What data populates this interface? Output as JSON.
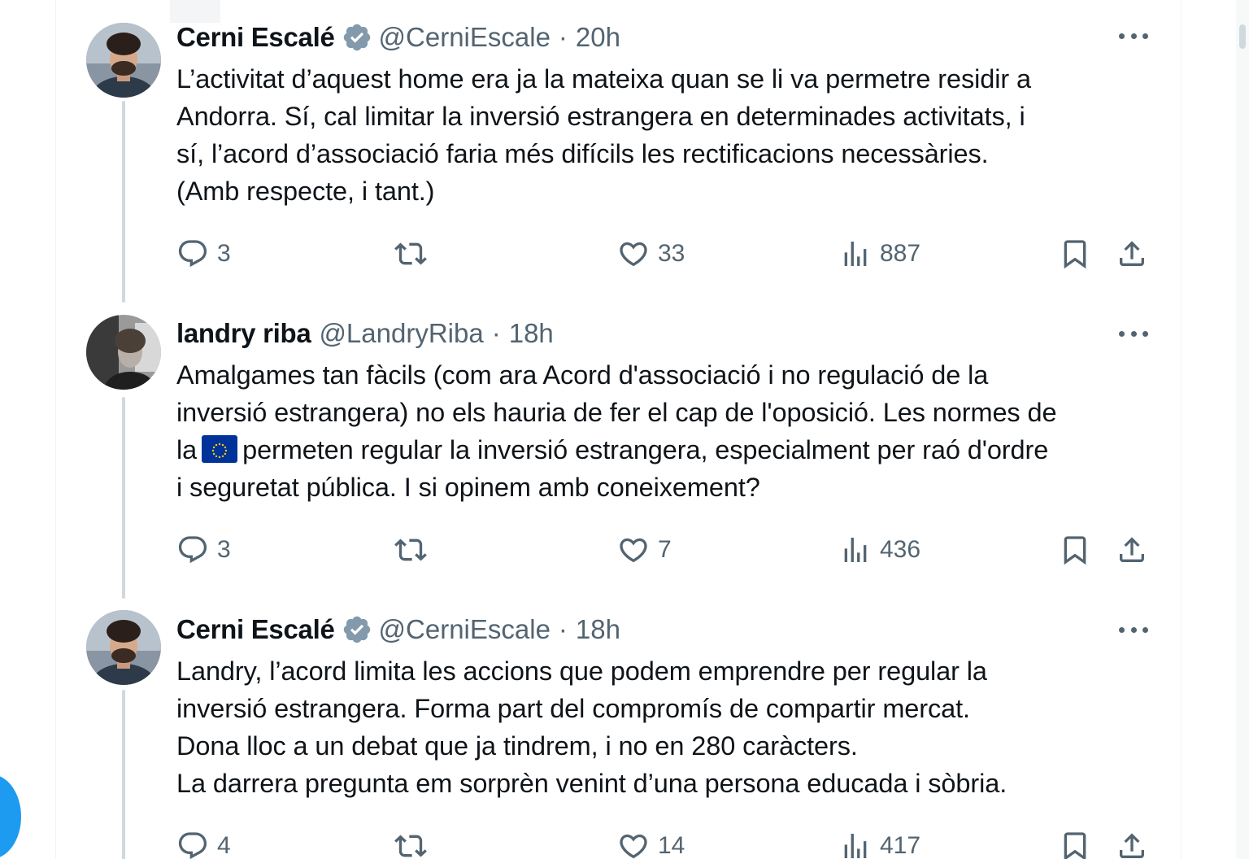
{
  "tweets": [
    {
      "name": "Cerni Escalé",
      "verified": true,
      "handle": "@CerniEscale",
      "dot": "·",
      "time": "20h",
      "lines": [
        "L’activitat d’aquest home era ja la mateixa quan se li va permetre residir a",
        "Andorra. Sí, cal limitar la inversió estrangera en determinades activitats, i",
        "sí, l’acord d’associació faria més difícils les rectificacions necessàries.",
        "(Amb respecte, i tant.)"
      ],
      "replies": "3",
      "retweets": "",
      "likes": "33",
      "views": "887"
    },
    {
      "name": "landry riba",
      "verified": false,
      "handle": "@LandryRiba",
      "dot": "·",
      "time": "18h",
      "lines": [
        "Amalgames tan fàcils (com ara Acord d'associació i no regulació de la",
        "inversió estrangera) no els hauria de fer el cap de l'oposició.  Les normes de"
      ],
      "line3_before": "la",
      "line3_after": "permeten regular la inversió estrangera, especialment per  raó d'ordre",
      "line4": "i seguretat pública. I si opinem amb coneixement?",
      "emoji": "eu-flag-icon",
      "replies": "3",
      "retweets": "",
      "likes": "7",
      "views": "436"
    },
    {
      "name": "Cerni Escalé",
      "verified": true,
      "handle": "@CerniEscale",
      "dot": "·",
      "time": "18h",
      "lines": [
        "Landry, l’acord limita les accions que podem emprendre per regular la",
        "inversió estrangera. Forma part del compromís de compartir mercat.",
        "Dona lloc a un debat que ja tindrem, i no en 280 caràcters.",
        "La darrera pregunta em sorprèn venint d’una persona educada i sòbria."
      ],
      "replies": "4",
      "retweets": "",
      "likes": "14",
      "views": "417"
    }
  ],
  "colors": {
    "text": "#0f1419",
    "secondary": "#536471",
    "verified": "#829aab",
    "thread_line": "#cfd9de",
    "fab": "#1d9bf0",
    "eu_blue": "#003399",
    "eu_star": "#ffcc00"
  },
  "icons": [
    "more-icon",
    "reply-icon",
    "retweet-icon",
    "like-icon",
    "views-icon",
    "bookmark-icon",
    "share-icon",
    "verified-badge-icon"
  ]
}
